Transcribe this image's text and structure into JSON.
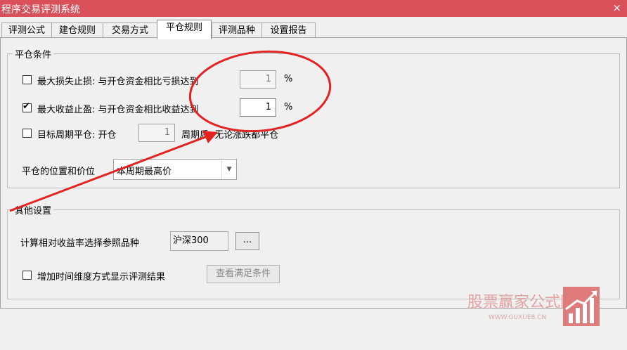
{
  "window": {
    "title": "程序交易评测系统",
    "close_glyph": "×"
  },
  "tabs": [
    {
      "label": "评测公式"
    },
    {
      "label": "建仓规则"
    },
    {
      "label": "交易方式"
    },
    {
      "label": "平仓规则"
    },
    {
      "label": "评测品种"
    },
    {
      "label": "设置报告"
    }
  ],
  "active_tab": "平仓规则",
  "close_conditions": {
    "group_title": "平仓条件",
    "max_loss": {
      "label": "最大损失止损: 与开仓资金相比亏损达到",
      "checked": false,
      "value": "1",
      "unit": "%"
    },
    "max_profit": {
      "label": "最大收益止盈: 与开仓资金相比收益达到",
      "checked": true,
      "value": "1",
      "unit": "%"
    },
    "target_period": {
      "label_prefix": "目标周期平仓: 开仓",
      "checked": false,
      "value": "1",
      "label_suffix": "周期后, 无论涨跌都平仓"
    },
    "position_price": {
      "label": "平仓的位置和价位",
      "selected": "本周期最高价"
    }
  },
  "other_settings": {
    "group_title": "其他设置",
    "ref_symbol_label": "计算相对收益率选择参照品种",
    "ref_symbol_value": "沪深300",
    "browse_label": "...",
    "time_dimension": {
      "label": "增加时间维度方式显示评测结果",
      "checked": false
    },
    "view_conditions_label": "查看满足条件"
  },
  "watermark": {
    "text": "股票赢家公式网",
    "url": "WWW.GUXUE8.CN"
  },
  "colors": {
    "titlebar": "#d9505a",
    "annotation": "#e32222",
    "watermark": "#e07b7b"
  }
}
